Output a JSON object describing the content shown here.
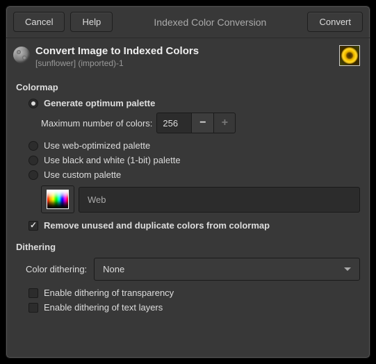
{
  "titlebar": {
    "cancel": "Cancel",
    "help": "Help",
    "title": "Indexed Color Conversion",
    "convert": "Convert"
  },
  "header": {
    "heading": "Convert Image to Indexed Colors",
    "subtitle": "[sunflower] (imported)-1"
  },
  "colormap": {
    "section": "Colormap",
    "generate": "Generate optimum palette",
    "max_label": "Maximum number of colors:",
    "max_value": "256",
    "web": "Use web-optimized palette",
    "bw": "Use black and white (1-bit) palette",
    "custom": "Use custom palette",
    "palette_name": "Web",
    "remove_unused": "Remove unused and duplicate colors from colormap"
  },
  "dithering": {
    "section": "Dithering",
    "label": "Color dithering:",
    "value": "None",
    "transparency": "Enable dithering of transparency",
    "text_layers": "Enable dithering of text layers"
  }
}
